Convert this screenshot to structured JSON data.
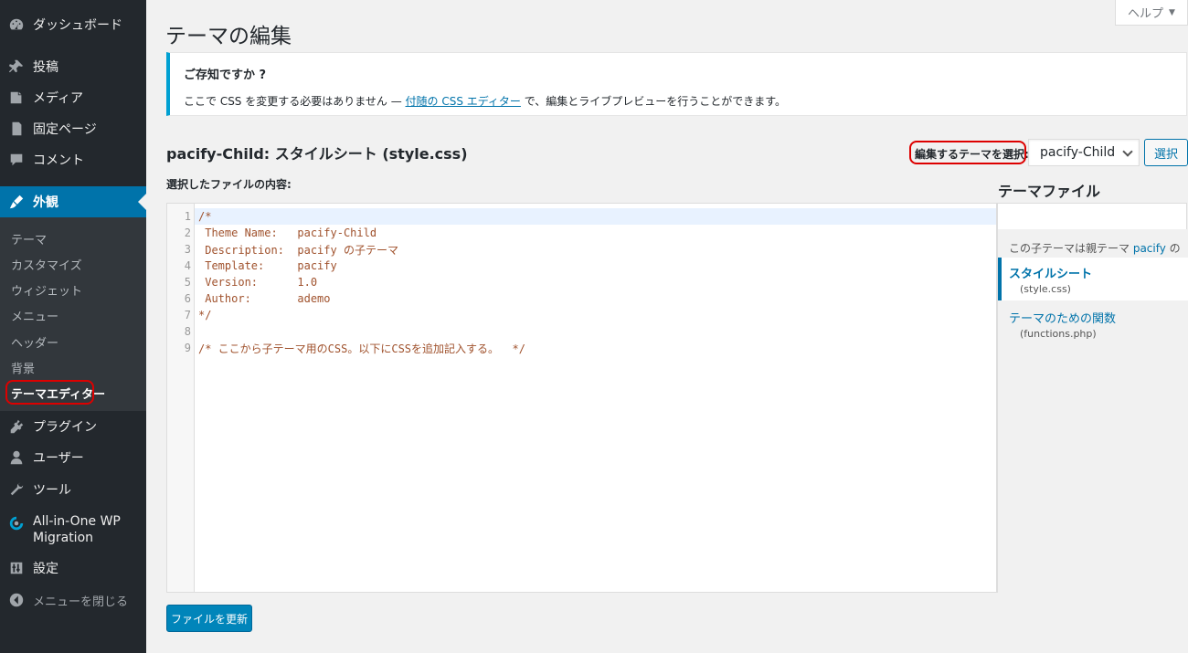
{
  "sidebar": {
    "dashboard": "ダッシュボード",
    "posts": "投稿",
    "media": "メディア",
    "pages": "固定ページ",
    "comments": "コメント",
    "appearance": "外観",
    "plugins": "プラグイン",
    "users": "ユーザー",
    "tools": "ツール",
    "migration_line1": "All-in-One WP",
    "migration_line2": "Migration",
    "settings": "設定",
    "collapse": "メニューを閉じる",
    "submenu": [
      "テーマ",
      "カスタマイズ",
      "ウィジェット",
      "メニュー",
      "ヘッダー",
      "背景",
      "テーマエディター"
    ]
  },
  "header": {
    "title": "テーマの編集",
    "help": "ヘルプ"
  },
  "notice": {
    "title": "ご存知ですか ?",
    "text_before": "ここで CSS を変更する必要はありません — ",
    "link": "付随の CSS エディター",
    "text_after": " で、編集とライブプレビューを行うことができます。"
  },
  "editor": {
    "file_title": "pacify-Child: スタイルシート (style.css)",
    "select_label": "編集するテーマを選択:",
    "selected_theme": "pacify-Child",
    "select_button": "選択",
    "content_label": "選択したファイルの内容:",
    "lines": [
      "/*",
      " Theme Name:   pacify-Child",
      " Description:  pacify の子テーマ",
      " Template:     pacify",
      " Version:      1.0",
      " Author:       ademo",
      "*/",
      "",
      "/* ここから子テーマ用のCSS。以下にCSSを追加記入する。  */"
    ],
    "update_button": "ファイルを更新"
  },
  "theme_files": {
    "title": "テーマファイル",
    "note_before": "この子テーマは親テーマ ",
    "note_link": "pacify",
    "note_after": " のテンプレートを引き継ぎます。",
    "files": [
      {
        "name": "スタイルシート",
        "path": "(style.css)"
      },
      {
        "name": "テーマのための関数",
        "path": "(functions.php)"
      }
    ]
  },
  "colors": {
    "sidebar_bg": "#23282d",
    "accent": "#0073aa",
    "highlight": "#dd0000"
  }
}
